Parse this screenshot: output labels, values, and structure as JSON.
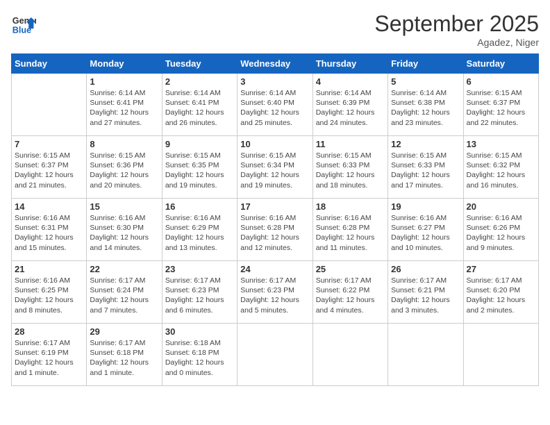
{
  "header": {
    "logo_line1": "General",
    "logo_line2": "Blue",
    "month_title": "September 2025",
    "location": "Agadez, Niger"
  },
  "weekdays": [
    "Sunday",
    "Monday",
    "Tuesday",
    "Wednesday",
    "Thursday",
    "Friday",
    "Saturday"
  ],
  "weeks": [
    [
      {
        "day": "",
        "sunrise": "",
        "sunset": "",
        "daylight": ""
      },
      {
        "day": "1",
        "sunrise": "6:14 AM",
        "sunset": "6:41 PM",
        "daylight": "12 hours and 27 minutes."
      },
      {
        "day": "2",
        "sunrise": "6:14 AM",
        "sunset": "6:41 PM",
        "daylight": "12 hours and 26 minutes."
      },
      {
        "day": "3",
        "sunrise": "6:14 AM",
        "sunset": "6:40 PM",
        "daylight": "12 hours and 25 minutes."
      },
      {
        "day": "4",
        "sunrise": "6:14 AM",
        "sunset": "6:39 PM",
        "daylight": "12 hours and 24 minutes."
      },
      {
        "day": "5",
        "sunrise": "6:14 AM",
        "sunset": "6:38 PM",
        "daylight": "12 hours and 23 minutes."
      },
      {
        "day": "6",
        "sunrise": "6:15 AM",
        "sunset": "6:37 PM",
        "daylight": "12 hours and 22 minutes."
      }
    ],
    [
      {
        "day": "7",
        "sunrise": "6:15 AM",
        "sunset": "6:37 PM",
        "daylight": "12 hours and 21 minutes."
      },
      {
        "day": "8",
        "sunrise": "6:15 AM",
        "sunset": "6:36 PM",
        "daylight": "12 hours and 20 minutes."
      },
      {
        "day": "9",
        "sunrise": "6:15 AM",
        "sunset": "6:35 PM",
        "daylight": "12 hours and 19 minutes."
      },
      {
        "day": "10",
        "sunrise": "6:15 AM",
        "sunset": "6:34 PM",
        "daylight": "12 hours and 19 minutes."
      },
      {
        "day": "11",
        "sunrise": "6:15 AM",
        "sunset": "6:33 PM",
        "daylight": "12 hours and 18 minutes."
      },
      {
        "day": "12",
        "sunrise": "6:15 AM",
        "sunset": "6:33 PM",
        "daylight": "12 hours and 17 minutes."
      },
      {
        "day": "13",
        "sunrise": "6:15 AM",
        "sunset": "6:32 PM",
        "daylight": "12 hours and 16 minutes."
      }
    ],
    [
      {
        "day": "14",
        "sunrise": "6:16 AM",
        "sunset": "6:31 PM",
        "daylight": "12 hours and 15 minutes."
      },
      {
        "day": "15",
        "sunrise": "6:16 AM",
        "sunset": "6:30 PM",
        "daylight": "12 hours and 14 minutes."
      },
      {
        "day": "16",
        "sunrise": "6:16 AM",
        "sunset": "6:29 PM",
        "daylight": "12 hours and 13 minutes."
      },
      {
        "day": "17",
        "sunrise": "6:16 AM",
        "sunset": "6:28 PM",
        "daylight": "12 hours and 12 minutes."
      },
      {
        "day": "18",
        "sunrise": "6:16 AM",
        "sunset": "6:28 PM",
        "daylight": "12 hours and 11 minutes."
      },
      {
        "day": "19",
        "sunrise": "6:16 AM",
        "sunset": "6:27 PM",
        "daylight": "12 hours and 10 minutes."
      },
      {
        "day": "20",
        "sunrise": "6:16 AM",
        "sunset": "6:26 PM",
        "daylight": "12 hours and 9 minutes."
      }
    ],
    [
      {
        "day": "21",
        "sunrise": "6:16 AM",
        "sunset": "6:25 PM",
        "daylight": "12 hours and 8 minutes."
      },
      {
        "day": "22",
        "sunrise": "6:17 AM",
        "sunset": "6:24 PM",
        "daylight": "12 hours and 7 minutes."
      },
      {
        "day": "23",
        "sunrise": "6:17 AM",
        "sunset": "6:23 PM",
        "daylight": "12 hours and 6 minutes."
      },
      {
        "day": "24",
        "sunrise": "6:17 AM",
        "sunset": "6:23 PM",
        "daylight": "12 hours and 5 minutes."
      },
      {
        "day": "25",
        "sunrise": "6:17 AM",
        "sunset": "6:22 PM",
        "daylight": "12 hours and 4 minutes."
      },
      {
        "day": "26",
        "sunrise": "6:17 AM",
        "sunset": "6:21 PM",
        "daylight": "12 hours and 3 minutes."
      },
      {
        "day": "27",
        "sunrise": "6:17 AM",
        "sunset": "6:20 PM",
        "daylight": "12 hours and 2 minutes."
      }
    ],
    [
      {
        "day": "28",
        "sunrise": "6:17 AM",
        "sunset": "6:19 PM",
        "daylight": "12 hours and 1 minute."
      },
      {
        "day": "29",
        "sunrise": "6:17 AM",
        "sunset": "6:18 PM",
        "daylight": "12 hours and 1 minute."
      },
      {
        "day": "30",
        "sunrise": "6:18 AM",
        "sunset": "6:18 PM",
        "daylight": "12 hours and 0 minutes."
      },
      {
        "day": "",
        "sunrise": "",
        "sunset": "",
        "daylight": ""
      },
      {
        "day": "",
        "sunrise": "",
        "sunset": "",
        "daylight": ""
      },
      {
        "day": "",
        "sunrise": "",
        "sunset": "",
        "daylight": ""
      },
      {
        "day": "",
        "sunrise": "",
        "sunset": "",
        "daylight": ""
      }
    ]
  ]
}
